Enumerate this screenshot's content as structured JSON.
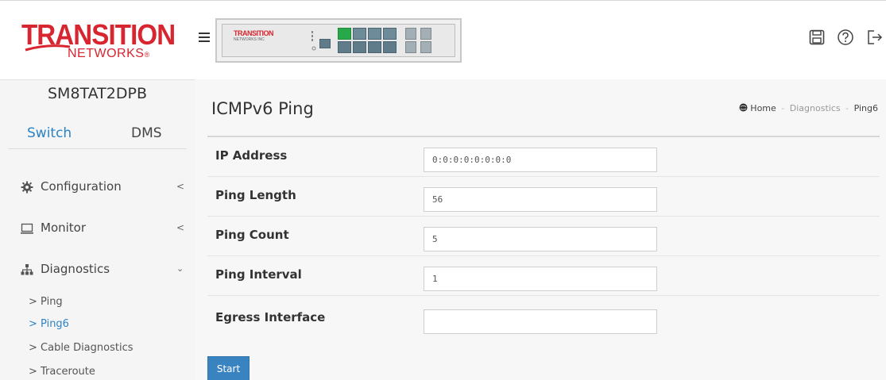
{
  "brand": {
    "logo_main": "TRANSITION",
    "logo_sub": "NETWORKS",
    "logo_mark": "®",
    "panel_logo": "TRANSITION",
    "panel_logo_sub": "NETWORKS INC"
  },
  "device_name": "SM8TAT2DPB",
  "tabs": {
    "switch_label": "Switch",
    "dms_label": "DMS",
    "active": "Switch"
  },
  "sidebar": {
    "menu": [
      {
        "label": "Configuration",
        "icon": "gear-icon",
        "expanded": false
      },
      {
        "label": "Monitor",
        "icon": "monitor-icon",
        "expanded": false
      },
      {
        "label": "Diagnostics",
        "icon": "sitemap-icon",
        "expanded": true
      }
    ],
    "submenu": [
      {
        "label": "> Ping",
        "active": false
      },
      {
        "label": "> Ping6",
        "active": true
      },
      {
        "label": "> Cable Diagnostics",
        "active": false
      },
      {
        "label": "> Traceroute",
        "active": false
      }
    ]
  },
  "topbar": {
    "icons": [
      "save-icon",
      "help-icon",
      "logout-icon"
    ]
  },
  "page": {
    "title": "ICMPv6 Ping",
    "breadcrumb": {
      "home": "Home",
      "section": "Diagnostics",
      "current": "Ping6",
      "separator": "-"
    }
  },
  "form": {
    "fields": [
      {
        "label": "IP Address",
        "value": "0:0:0:0:0:0:0:0"
      },
      {
        "label": "Ping Length",
        "value": "56"
      },
      {
        "label": "Ping Count",
        "value": "5"
      },
      {
        "label": "Ping Interval",
        "value": "1"
      },
      {
        "label": "Egress Interface",
        "value": ""
      }
    ],
    "start_label": "Start"
  },
  "colors": {
    "accent": "#2b83c5",
    "brand_red": "#d7262f",
    "button_blue": "#3a83c1",
    "port_link_green": "#27a84a"
  }
}
